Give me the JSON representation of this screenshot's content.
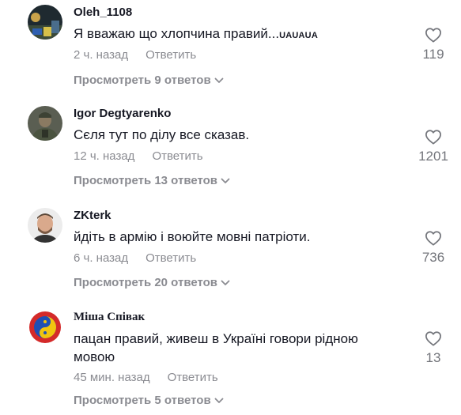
{
  "comments": [
    {
      "username": "Oleh_1108",
      "text": "Я вважаю що хлопчина правий...",
      "text_suffix": "UAUAUA",
      "time": "2 ч. назад",
      "reply_label": "Ответить",
      "view_replies": "Просмотреть 9 ответов",
      "likes": "119"
    },
    {
      "username": "Igor Degtyarenko",
      "text": "Сєля тут по ділу все сказав.",
      "time": "12 ч. назад",
      "reply_label": "Ответить",
      "view_replies": "Просмотреть 13 ответов",
      "likes": "1201"
    },
    {
      "username": "ZKterk",
      "text": "йдіть в армію і воюйте мовні патріоти.",
      "time": "6 ч. назад",
      "reply_label": "Ответить",
      "view_replies": "Просмотреть 20 ответов",
      "likes": "736"
    },
    {
      "username": "Міша Співак",
      "text": "пацан правий, живеш в Україні говори рідною мовою",
      "time": "45 мин. назад",
      "reply_label": "Ответить",
      "view_replies": "Просмотреть 5 ответов",
      "likes": "13"
    }
  ],
  "icons": {
    "like": "heart-outline-icon",
    "expand": "chevron-down-icon"
  },
  "colors": {
    "text": "#161823",
    "muted": "#8a8b91",
    "count": "#73757b"
  }
}
